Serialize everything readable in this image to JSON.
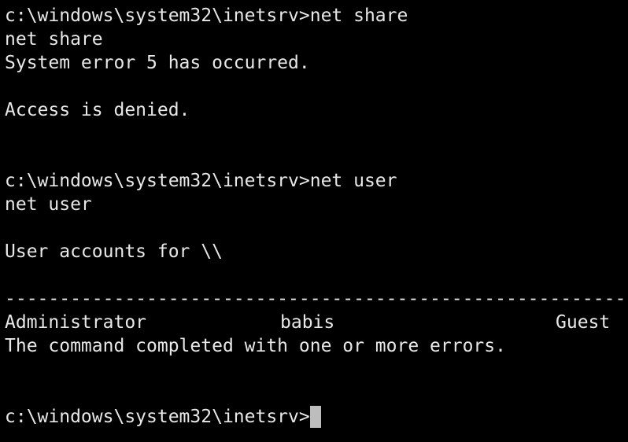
{
  "terminal": {
    "colors": {
      "background": "#000000",
      "foreground": "#e8e8e8",
      "cursor": "#bdbdbd"
    },
    "lines": {
      "cmd1_prompt": "c:\\windows\\system32\\inetsrv>net share",
      "cmd1_echo": "net share",
      "error_line": "System error 5 has occurred.",
      "denied_line": "Access is denied.",
      "cmd2_prompt": "c:\\windows\\system32\\inetsrv>net user",
      "cmd2_echo": "net user",
      "accounts_header": "User accounts for \\\\",
      "separator": "-------------------------------------------------------------------------------",
      "completed_line": "The command completed with one or more errors."
    },
    "accounts": [
      "Administrator",
      "babis",
      "Guest"
    ],
    "current_prompt": "c:\\windows\\system32\\inetsrv>"
  }
}
